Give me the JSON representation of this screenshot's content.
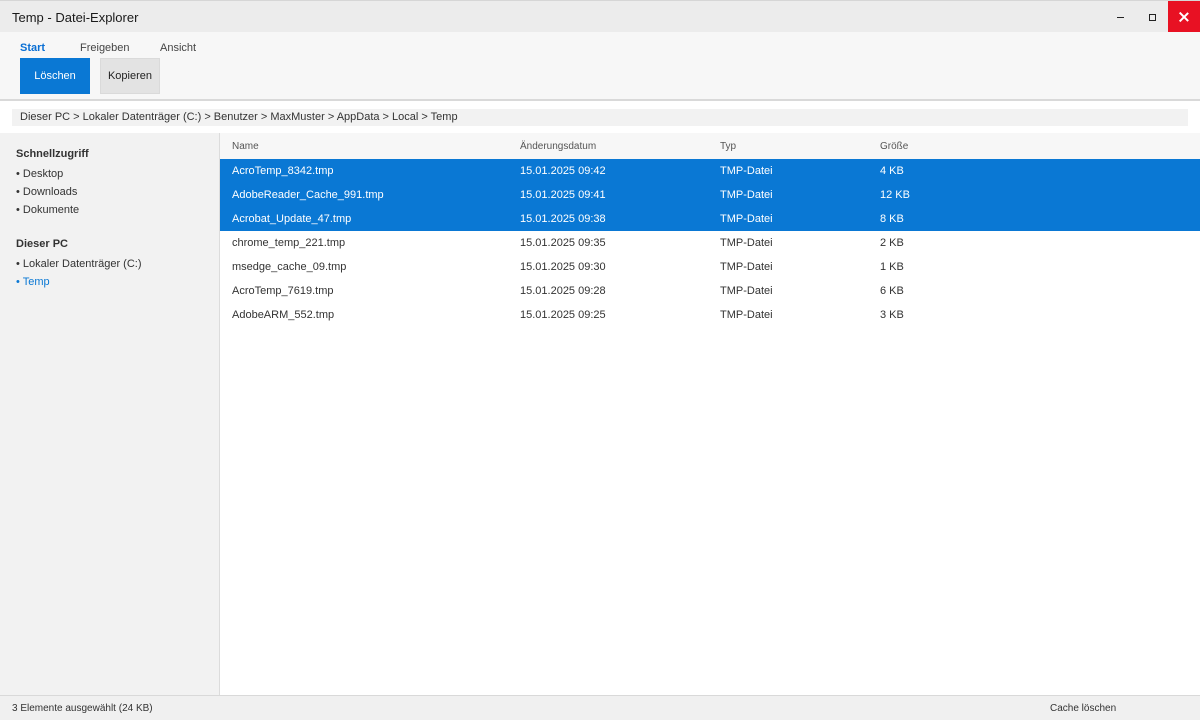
{
  "window": {
    "title": "Temp - Datei-Explorer",
    "close_color": "#e81123"
  },
  "ribbon": {
    "tabs": [
      {
        "label": "Start",
        "active": true
      },
      {
        "label": "Freigeben",
        "active": false
      },
      {
        "label": "Ansicht",
        "active": false
      }
    ],
    "buttons": {
      "delete_label": "Löschen",
      "copy_label": "Kopieren"
    },
    "accent_color": "#0a78d4"
  },
  "address": {
    "path": "Dieser PC > Lokaler Datenträger (C:) > Benutzer > MaxMuster > AppData > Local > Temp"
  },
  "sidebar": {
    "quick_access": {
      "heading": "Schnellzugriff",
      "items": [
        "• Desktop",
        "• Downloads",
        "• Dokumente"
      ]
    },
    "this_pc": {
      "heading": "Dieser PC",
      "items": [
        "• Lokaler Datenträger (C:)",
        "• Temp"
      ]
    }
  },
  "filelist": {
    "columns": {
      "name": "Name",
      "date": "Änderungsdatum",
      "type": "Typ",
      "size": "Größe"
    },
    "rows": [
      {
        "name": "AcroTemp_8342.tmp",
        "date": "15.01.2025 09:42",
        "type": "TMP-Datei",
        "size": "4 KB",
        "selected": true
      },
      {
        "name": "AdobeReader_Cache_991.tmp",
        "date": "15.01.2025 09:41",
        "type": "TMP-Datei",
        "size": "12 KB",
        "selected": true
      },
      {
        "name": "Acrobat_Update_47.tmp",
        "date": "15.01.2025 09:38",
        "type": "TMP-Datei",
        "size": "8 KB",
        "selected": true
      },
      {
        "name": "chrome_temp_221.tmp",
        "date": "15.01.2025 09:35",
        "type": "TMP-Datei",
        "size": "2 KB",
        "selected": false
      },
      {
        "name": "msedge_cache_09.tmp",
        "date": "15.01.2025 09:30",
        "type": "TMP-Datei",
        "size": "1 KB",
        "selected": false
      },
      {
        "name": "AcroTemp_7619.tmp",
        "date": "15.01.2025 09:28",
        "type": "TMP-Datei",
        "size": "6 KB",
        "selected": false
      },
      {
        "name": "AdobeARM_552.tmp",
        "date": "15.01.2025 09:25",
        "type": "TMP-Datei",
        "size": "3 KB",
        "selected": false
      }
    ]
  },
  "statusbar": {
    "selection_text": "3 Elemente ausgewählt (24 KB)",
    "action_label": "Cache löschen"
  }
}
